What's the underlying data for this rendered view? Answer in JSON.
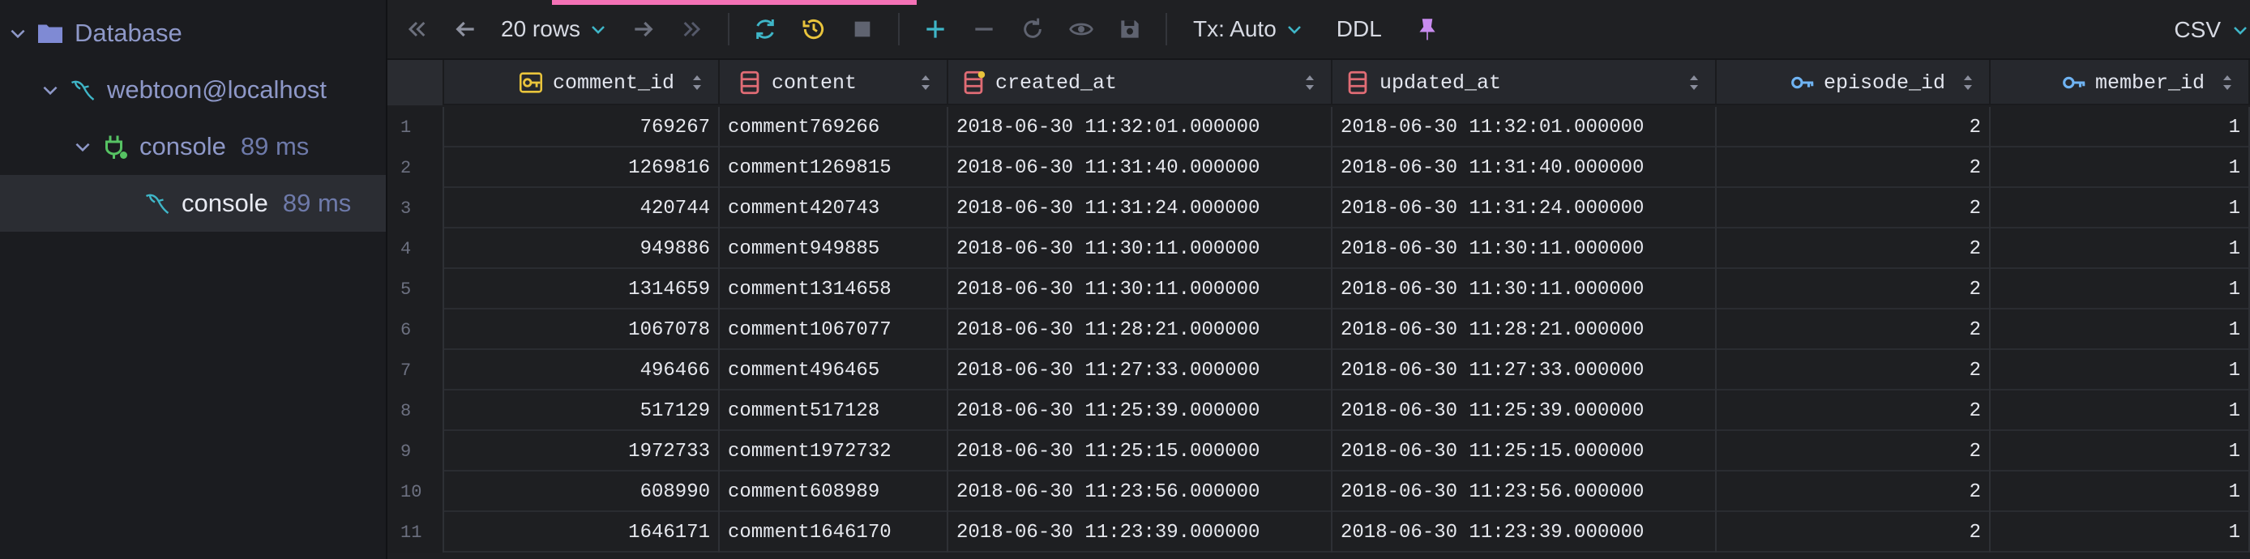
{
  "sidebar": {
    "items": [
      {
        "label": "Database",
        "time": ""
      },
      {
        "label": "webtoon@localhost",
        "time": ""
      },
      {
        "label": "console",
        "time": "89 ms"
      },
      {
        "label": "console",
        "time": "89 ms"
      }
    ]
  },
  "toolbar": {
    "rows_label": "20 rows",
    "tx_label": "Tx: Auto",
    "ddl_label": "DDL",
    "csv_label": "CSV",
    "icons": [
      "first-page-icon",
      "prev-page-icon",
      "next-page-icon",
      "last-page-icon",
      "refresh-icon",
      "history-icon",
      "stop-icon",
      "add-row-icon",
      "delete-row-icon",
      "revert-icon",
      "preview-icon",
      "save-icon",
      "pin-icon"
    ]
  },
  "grid": {
    "columns": [
      {
        "name": "comment_id",
        "icon": "primary-key-icon"
      },
      {
        "name": "content",
        "icon": "column-icon"
      },
      {
        "name": "created_at",
        "icon": "column-icon"
      },
      {
        "name": "updated_at",
        "icon": "column-icon"
      },
      {
        "name": "episode_id",
        "icon": "foreign-key-icon"
      },
      {
        "name": "member_id",
        "icon": "foreign-key-icon"
      }
    ],
    "rows": [
      {
        "n": "1",
        "comment_id": "769267",
        "content": "comment769266",
        "created_at": "2018-06-30 11:32:01.000000",
        "updated_at": "2018-06-30 11:32:01.000000",
        "episode_id": "2",
        "member_id": "1"
      },
      {
        "n": "2",
        "comment_id": "1269816",
        "content": "comment1269815",
        "created_at": "2018-06-30 11:31:40.000000",
        "updated_at": "2018-06-30 11:31:40.000000",
        "episode_id": "2",
        "member_id": "1"
      },
      {
        "n": "3",
        "comment_id": "420744",
        "content": "comment420743",
        "created_at": "2018-06-30 11:31:24.000000",
        "updated_at": "2018-06-30 11:31:24.000000",
        "episode_id": "2",
        "member_id": "1"
      },
      {
        "n": "4",
        "comment_id": "949886",
        "content": "comment949885",
        "created_at": "2018-06-30 11:30:11.000000",
        "updated_at": "2018-06-30 11:30:11.000000",
        "episode_id": "2",
        "member_id": "1"
      },
      {
        "n": "5",
        "comment_id": "1314659",
        "content": "comment1314658",
        "created_at": "2018-06-30 11:30:11.000000",
        "updated_at": "2018-06-30 11:30:11.000000",
        "episode_id": "2",
        "member_id": "1"
      },
      {
        "n": "6",
        "comment_id": "1067078",
        "content": "comment1067077",
        "created_at": "2018-06-30 11:28:21.000000",
        "updated_at": "2018-06-30 11:28:21.000000",
        "episode_id": "2",
        "member_id": "1"
      },
      {
        "n": "7",
        "comment_id": "496466",
        "content": "comment496465",
        "created_at": "2018-06-30 11:27:33.000000",
        "updated_at": "2018-06-30 11:27:33.000000",
        "episode_id": "2",
        "member_id": "1"
      },
      {
        "n": "8",
        "comment_id": "517129",
        "content": "comment517128",
        "created_at": "2018-06-30 11:25:39.000000",
        "updated_at": "2018-06-30 11:25:39.000000",
        "episode_id": "2",
        "member_id": "1"
      },
      {
        "n": "9",
        "comment_id": "1972733",
        "content": "comment1972732",
        "created_at": "2018-06-30 11:25:15.000000",
        "updated_at": "2018-06-30 11:25:15.000000",
        "episode_id": "2",
        "member_id": "1"
      },
      {
        "n": "10",
        "comment_id": "608990",
        "content": "comment608989",
        "created_at": "2018-06-30 11:23:56.000000",
        "updated_at": "2018-06-30 11:23:56.000000",
        "episode_id": "2",
        "member_id": "1"
      },
      {
        "n": "11",
        "comment_id": "1646171",
        "content": "comment1646170",
        "created_at": "2018-06-30 11:23:39.000000",
        "updated_at": "2018-06-30 11:23:39.000000",
        "episode_id": "2",
        "member_id": "1"
      }
    ]
  },
  "colors": {
    "accent_pink": "#f472b6",
    "key_yellow": "#e9c43c",
    "key_blue": "#6fb3f2",
    "column_red": "#e06c75",
    "refresh_teal": "#3fb6c8",
    "history_yellow": "#e9c43c",
    "plus_teal": "#3fb6c8",
    "pin_purple": "#c98cf0",
    "node_green": "#56c263"
  }
}
